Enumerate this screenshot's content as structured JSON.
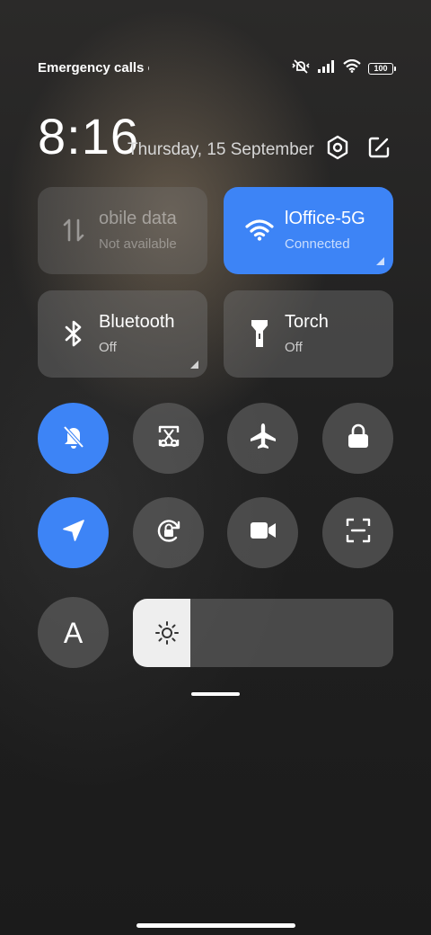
{
  "status_bar": {
    "carrier_text": "Emergency calls o",
    "battery_level": "100",
    "icons": [
      "mute-vibrate-icon",
      "signal-icon",
      "wifi-icon",
      "battery-icon"
    ]
  },
  "header": {
    "time": "8:16",
    "date": "Thursday, 15 September",
    "settings_icon": "settings-hexagon-icon",
    "edit_icon": "edit-icon"
  },
  "tiles": {
    "mobile_data": {
      "name": "obile data",
      "status": "Not available",
      "active": false
    },
    "wifi": {
      "name": "lOffice-5G",
      "status": "Connected",
      "active": true
    },
    "bluetooth": {
      "name": "Bluetooth",
      "status": "Off",
      "active": false
    },
    "torch": {
      "name": "Torch",
      "status": "Off",
      "active": false
    }
  },
  "toggles": [
    {
      "icon": "bell-off-icon",
      "active": true
    },
    {
      "icon": "screenshot-scissors-icon",
      "active": false
    },
    {
      "icon": "airplane-icon",
      "active": false
    },
    {
      "icon": "lock-icon",
      "active": false
    },
    {
      "icon": "location-icon",
      "active": true
    },
    {
      "icon": "rotation-lock-icon",
      "active": false
    },
    {
      "icon": "video-camera-icon",
      "active": false
    },
    {
      "icon": "scan-icon",
      "active": false
    }
  ],
  "font_toggle": {
    "label": "A"
  },
  "brightness": {
    "level": 0.22
  },
  "colors": {
    "accent": "#3d84f6",
    "tile_grey": "#5a5a5a",
    "background": "#202020"
  }
}
